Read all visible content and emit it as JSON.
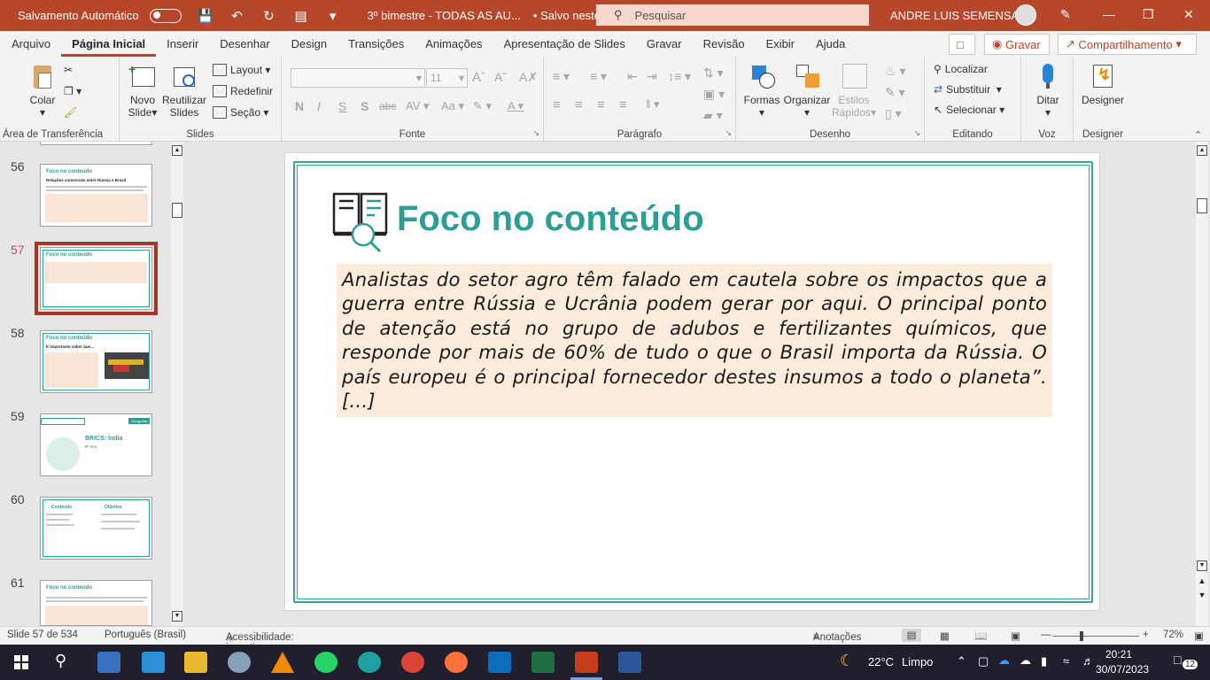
{
  "titlebar": {
    "autosave_label": "Salvamento Automático",
    "doc_title": "3º bimestre - TODAS AS AU...",
    "saved_status": "• Salvo neste PC",
    "search_placeholder": "Pesquisar",
    "user_name": "ANDRE LUIS SEMENSATO"
  },
  "tabs": [
    "Arquivo",
    "Página Inicial",
    "Inserir",
    "Desenhar",
    "Design",
    "Transições",
    "Animações",
    "Apresentação de Slides",
    "Gravar",
    "Revisão",
    "Exibir",
    "Ajuda"
  ],
  "tab_actions": {
    "record": "Gravar",
    "share": "Compartilhamento"
  },
  "ribbon": {
    "clipboard": {
      "label": "Área de Transferência",
      "paste": "Colar"
    },
    "slides": {
      "label": "Slides",
      "new_slide_1": "Novo",
      "new_slide_2": "Slide",
      "reuse_1": "Reutilizar",
      "reuse_2": "Slides",
      "layout": "Layout",
      "reset": "Redefinir",
      "section": "Seção"
    },
    "font": {
      "label": "Fonte",
      "size": "11",
      "bold": "N",
      "italic": "I",
      "underline": "S",
      "shadow": "S",
      "strike": "abc"
    },
    "paragraph": {
      "label": "Parágrafo"
    },
    "drawing": {
      "label": "Desenho",
      "shapes": "Formas",
      "arrange": "Organizar",
      "styles_1": "Estilos",
      "styles_2": "Rápidos"
    },
    "editing": {
      "label": "Editando",
      "find": "Localizar",
      "replace": "Substituir",
      "select": "Selecionar"
    },
    "voice": {
      "label": "Voz",
      "dictate": "Ditar"
    },
    "designer": {
      "label": "Designer",
      "button": "Designer"
    }
  },
  "thumbnails": [
    {
      "num": "56",
      "title": "Foco no conteúdo",
      "subtitle": "Relações comerciais entre Rússia e Brasil"
    },
    {
      "num": "57",
      "title": "Foco no conteúdo",
      "selected": true
    },
    {
      "num": "58",
      "title": "Foco no conteúdo",
      "subtitle": "É importante saber que..."
    },
    {
      "num": "59",
      "title": "BRICS: Índia",
      "subtitle": "9º Ano",
      "tag": "Geografia"
    },
    {
      "num": "60",
      "title": "Conteúdo",
      "subtitle": "Objetivo"
    },
    {
      "num": "61",
      "title": "Foco no conteúdo"
    }
  ],
  "slide": {
    "title": "Foco no conteúdo",
    "quote": "Analistas do setor agro têm falado em cautela sobre os impactos que a guerra entre Rússia e Ucrânia podem gerar por aqui. O principal ponto de atenção está no grupo de adubos e fertilizantes químicos, que responde por mais de 60% de tudo o que o Brasil importa da Rússia. O país europeu é o principal fornecedor destes insumos a todo o planeta”.[...]"
  },
  "statusbar": {
    "slide_count": "Slide 57 de 534",
    "language": "Português (Brasil)",
    "accessibility": "Acessibilidade: investigar",
    "notes": "Anotações",
    "zoom": "72%"
  },
  "taskbar": {
    "weather_temp": "22°C",
    "weather_desc": "Limpo",
    "time": "20:21",
    "date": "30/07/2023",
    "notifications": "12"
  },
  "colors": {
    "accent": "#b7472a",
    "teal": "#2e9e95",
    "quote_bg": "#fdebdc"
  }
}
